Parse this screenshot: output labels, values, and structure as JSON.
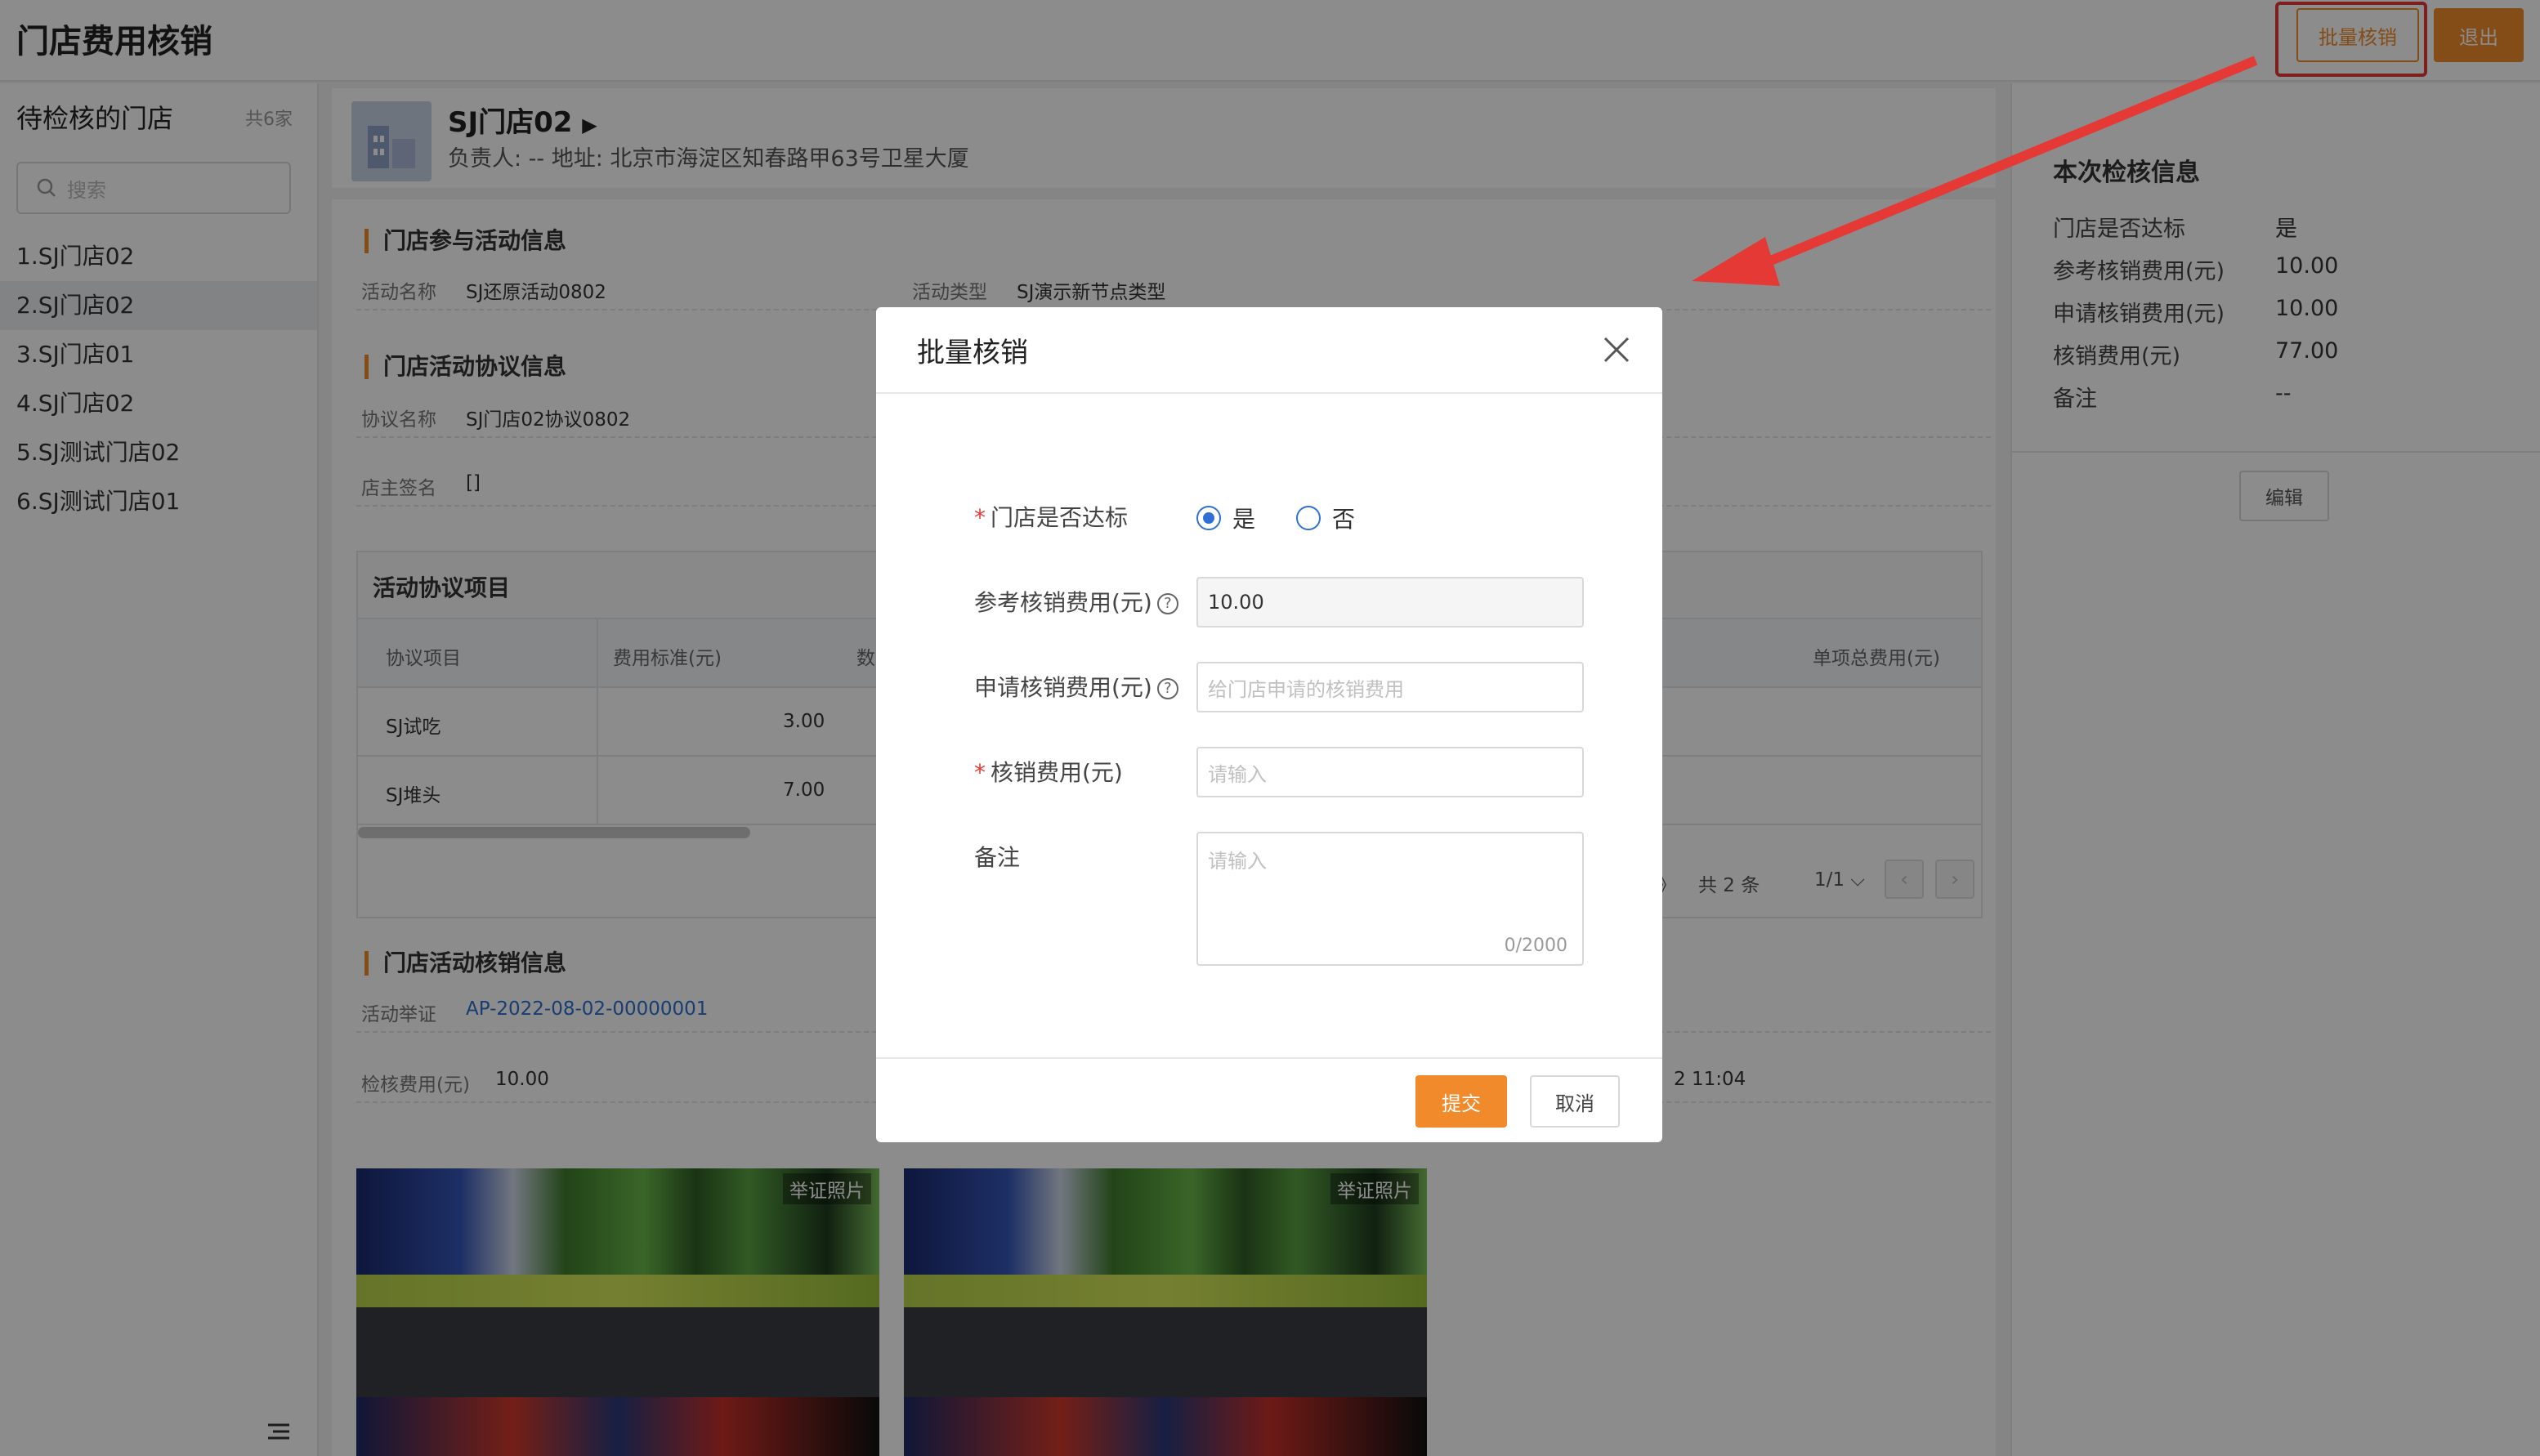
{
  "header": {
    "title": "门店费用核销",
    "batch_button": "批量核销",
    "exit_button": "退出"
  },
  "sidebar": {
    "title": "待检核的门店",
    "count": "共6家",
    "search_placeholder": "搜索",
    "items": [
      {
        "label": "1.SJ门店02"
      },
      {
        "label": "2.SJ门店02"
      },
      {
        "label": "3.SJ门店01"
      },
      {
        "label": "4.SJ门店02"
      },
      {
        "label": "5.SJ测试门店02"
      },
      {
        "label": "6.SJ测试门店01"
      }
    ]
  },
  "store": {
    "name": "SJ门店02",
    "meta": "负责人: --     地址: 北京市海淀区知春路甲63号卫星大厦"
  },
  "activity": {
    "section_title": "门店参与活动信息",
    "name_label": "活动名称",
    "name_value": "SJ还原活动0802",
    "type_label": "活动类型",
    "type_value": "SJ演示新节点类型"
  },
  "agreement": {
    "section_title": "门店活动协议信息",
    "name_label": "协议名称",
    "name_value": "SJ门店02协议0802",
    "sign_label": "店主签名",
    "sign_value": "[]"
  },
  "table": {
    "title": "活动协议项目",
    "headers": [
      "协议项目",
      "费用标准(元)",
      "数",
      "单项总费用(元)"
    ],
    "rows": [
      {
        "item": "SJ试吃",
        "standard": "3.00"
      },
      {
        "item": "SJ堆头",
        "standard": "7.00"
      }
    ],
    "pager_partial": "》",
    "pager_total": "共 2 条",
    "pager_page": "1/1 ⌵",
    "prev": "‹",
    "next": "›"
  },
  "verification": {
    "section_title": "门店活动核销信息",
    "proof_label": "活动举证",
    "proof_value": "AP-2022-08-02-00000001",
    "fee_label": "检核费用(元)",
    "fee_value": "10.00",
    "time_partial": "2 11:04",
    "photo_badge": "举证照片"
  },
  "rightpanel": {
    "title": "本次检核信息",
    "rows": [
      {
        "label": "门店是否达标",
        "value": "是"
      },
      {
        "label": "参考核销费用(元)",
        "value": "10.00"
      },
      {
        "label": "申请核销费用(元)",
        "value": "10.00"
      },
      {
        "label": "核销费用(元)",
        "value": "77.00"
      },
      {
        "label": "备注",
        "value": "--"
      }
    ],
    "edit_button": "编辑"
  },
  "modal": {
    "title": "批量核销",
    "fields": {
      "qualified_label": "门店是否达标",
      "yes": "是",
      "no": "否",
      "ref_fee_label": "参考核销费用(元)",
      "ref_fee_value": "10.00",
      "apply_fee_label": "申请核销费用(元)",
      "apply_fee_placeholder": "给门店申请的核销费用",
      "fee_label": "核销费用(元)",
      "fee_placeholder": "请输入",
      "remark_label": "备注",
      "remark_placeholder": "请输入",
      "remark_counter": "0/2000"
    },
    "submit": "提交",
    "cancel": "取消"
  },
  "colors": {
    "accent": "#f08a2b",
    "highlight": "#e53935",
    "radio": "#2f6fd6"
  }
}
